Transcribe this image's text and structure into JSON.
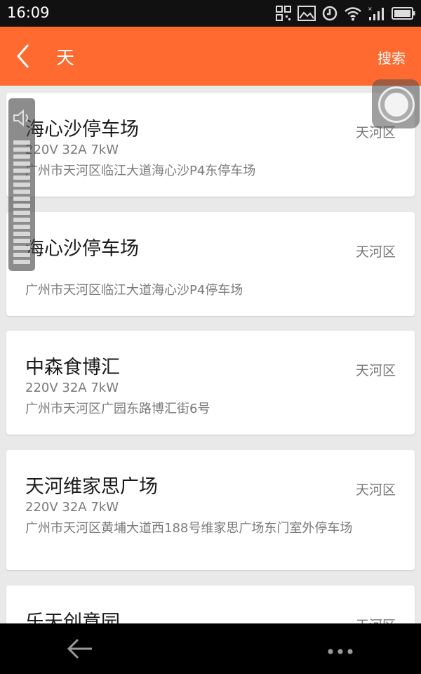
{
  "status_bar": {
    "time": "16:09",
    "icons": [
      "qr-code-icon",
      "image-icon",
      "sync-icon",
      "wifi-icon",
      "signal-icon",
      "battery-icon"
    ]
  },
  "app_bar": {
    "title": "天",
    "search_label": "搜索",
    "accent_color": "#ff6a30"
  },
  "stations": [
    {
      "name": "海心沙停车场",
      "district": "天河区",
      "spec": "220V 32A 7kW",
      "address": "广州市天河区临江大道海心沙P4东停车场"
    },
    {
      "name": "海心沙停车场",
      "district": "天河区",
      "spec": "",
      "address": "广州市天河区临江大道海心沙P4停车场"
    },
    {
      "name": "中森食博汇",
      "district": "天河区",
      "spec": "220V 32A 7kW",
      "address": "广州市天河区广园东路博汇街6号"
    },
    {
      "name": "天河维家思广场",
      "district": "天河区",
      "spec": "220V 32A 7kW",
      "address": "广州市天河区黄埔大道西188号维家思广场东门室外停车场"
    },
    {
      "name": "乐天创意园",
      "district": "天河区",
      "spec": "",
      "address": ""
    }
  ],
  "overlays": {
    "volume_level_fraction": 1.0,
    "assistive_icon": "assistive-touch-icon"
  },
  "nav_bar": {
    "icons": [
      "back-arrow-icon",
      "more-options-icon"
    ]
  }
}
